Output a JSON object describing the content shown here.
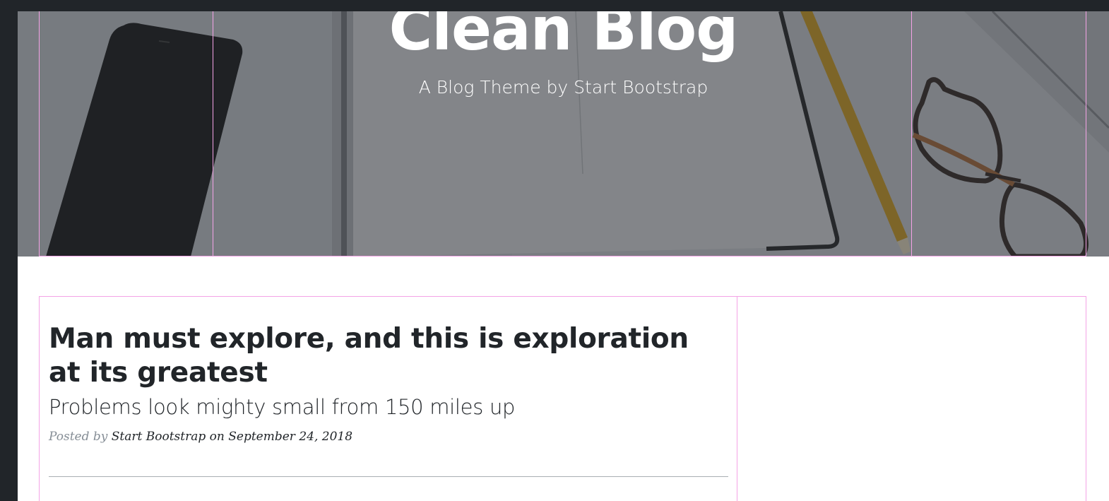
{
  "masthead": {
    "title": "Clean Blog",
    "subtitle": "A Blog Theme by Start Bootstrap"
  },
  "posts": [
    {
      "title": "Man must explore, and this is exploration at its greatest",
      "subtitle": "Problems look mighty small from 150 miles up",
      "meta_prefix": "Posted by",
      "author": "Start Bootstrap",
      "date": "on September 24, 2018"
    }
  ],
  "colors": {
    "page_frame": "#212529",
    "guide": "#f4a3e6",
    "heading_text": "#212529",
    "meta_text": "#868e96"
  }
}
